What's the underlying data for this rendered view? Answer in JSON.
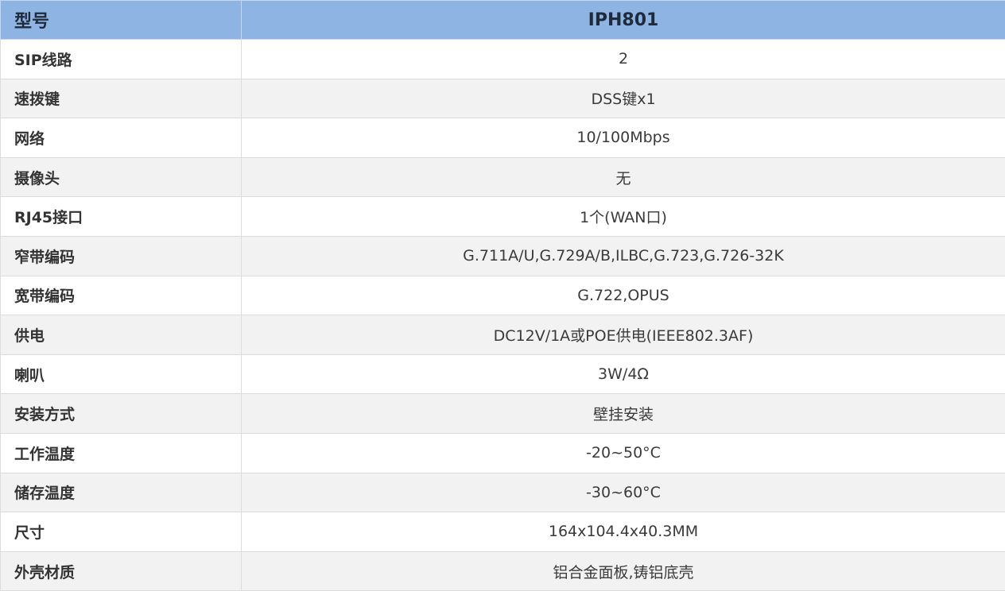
{
  "header": {
    "label": "型号",
    "value": "IPH801"
  },
  "rows": [
    {
      "label": "SIP线路",
      "value": "2"
    },
    {
      "label": "速拨键",
      "value": "DSS键x1"
    },
    {
      "label": "网络",
      "value": "10/100Mbps"
    },
    {
      "label": "摄像头",
      "value": "无"
    },
    {
      "label": "RJ45接口",
      "value": "1个(WAN口)"
    },
    {
      "label": "窄带编码",
      "value": "G.711A/U,G.729A/B,ILBC,G.723,G.726-32K"
    },
    {
      "label": "宽带编码",
      "value": "G.722,OPUS"
    },
    {
      "label": "供电",
      "value": "DC12V/1A或POE供电(IEEE802.3AF)"
    },
    {
      "label": "喇叭",
      "value": "3W/4Ω"
    },
    {
      "label": "安装方式",
      "value": "壁挂安装"
    },
    {
      "label": "工作温度",
      "value": "-20~50°C"
    },
    {
      "label": "储存温度",
      "value": "-30~60°C"
    },
    {
      "label": "尺寸",
      "value": "164x104.4x40.3MM"
    },
    {
      "label": "外壳材质",
      "value": "铝合金面板,铸铝底壳"
    }
  ],
  "colors": {
    "header_bg": "#8db4e2",
    "row_alt_bg": "#f2f2f2",
    "border": "#dcdcdc"
  }
}
